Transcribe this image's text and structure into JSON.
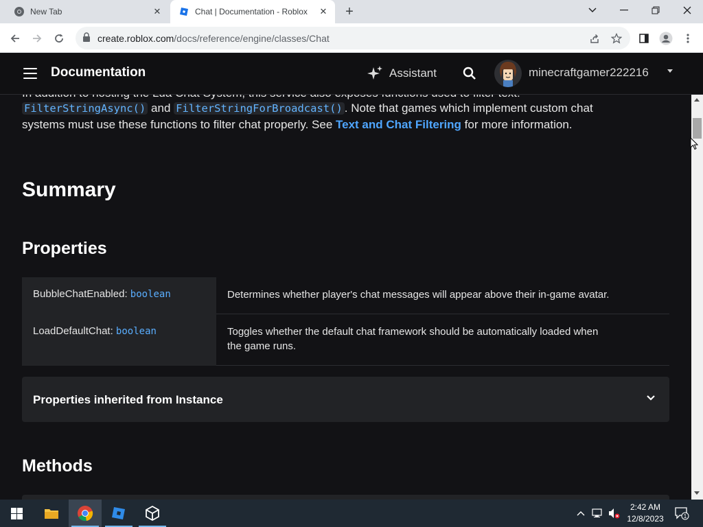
{
  "browser": {
    "tabs": [
      {
        "title": "New Tab"
      },
      {
        "title": "Chat | Documentation - Roblox"
      }
    ],
    "url_host": "create.roblox.com",
    "url_path": "/docs/reference/engine/classes/Chat"
  },
  "header": {
    "brand": "Documentation",
    "assistant_label": "Assistant",
    "username": "minecraftgamer222216"
  },
  "intro": {
    "line0": "In addition to hosting the Lua Chat System, this service also exposes functions used to filter text:",
    "code1": "FilterStringAsync()",
    "and": "and",
    "code2": "FilterStringForBroadcast()",
    "line1_rest": ". Note that games which implement custom chat",
    "line2_start": "systems must use these functions to filter chat properly. See",
    "link": "Text and Chat Filtering",
    "line2_end": "for more information."
  },
  "summary_heading": "Summary",
  "properties_heading": "Properties",
  "properties": [
    {
      "name": "BubbleChatEnabled:",
      "type": "boolean",
      "description": "Determines whether player's chat messages will appear above their in-game avatar."
    },
    {
      "name": "LoadDefaultChat:",
      "type": "boolean",
      "description_line1": "Toggles whether the default chat framework should be automatically loaded when",
      "description_line2": "the game runs."
    }
  ],
  "inherited_label": "Properties inherited from Instance",
  "methods_heading": "Methods",
  "taskbar": {
    "time": "2:42 AM",
    "date": "12/8/2023",
    "notification_count": "1"
  },
  "colors": {
    "page_bg": "#121215",
    "panel_bg": "#222326",
    "link": "#4fa6ff",
    "code": "#63b4ff"
  }
}
